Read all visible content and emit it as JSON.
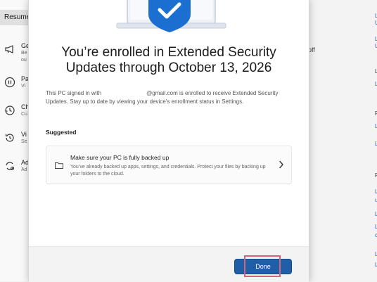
{
  "background": {
    "resume_label": "Resume",
    "rows": [
      {
        "l1": "Ge",
        "l2": "Be",
        "l3": "ou"
      },
      {
        "l1": "Pa",
        "l2": "Vi",
        "l3": ""
      },
      {
        "l1": "Ch",
        "l2": "Cu",
        "l3": ""
      },
      {
        "l1": "Vi",
        "l2": "Se",
        "l3": ""
      },
      {
        "l1": "Ad",
        "l2": "Ad",
        "l3": ""
      }
    ],
    "off_text": "off"
  },
  "dialog": {
    "title_line1": "You’re enrolled in Extended Security",
    "title_line2": "Updates through October 13, 2026",
    "desc_part1": "This PC signed in with",
    "desc_part2": "@gmail.com is enrolled to receive Extended Security Updates. Stay up to date by viewing your device’s enrollment status in Settings.",
    "suggested_label": "Suggested",
    "card_title": "Make sure your PC is fully backed up",
    "card_subtitle": "You’ve already backed up apps, settings, and credentials. Protect your files by backing up your folders to the cloud.",
    "done_label": "Done"
  },
  "colors": {
    "accent": "#1f5fa8",
    "highlight": "#d6627a",
    "shield": "#1a6fd1"
  }
}
